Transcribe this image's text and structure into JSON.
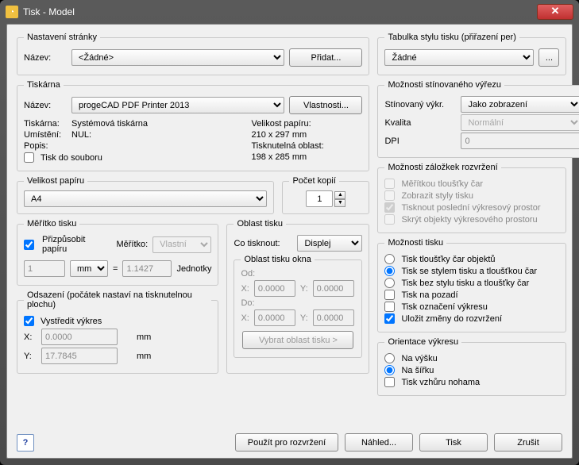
{
  "window": {
    "title": "Tisk - Model"
  },
  "pageSetup": {
    "legend": "Nastavení stránky",
    "nameLabel": "Název:",
    "nameValue": "<Žádné>",
    "addBtn": "Přidat..."
  },
  "styleTable": {
    "legend": "Tabulka stylu tisku (přiřazení per)",
    "value": "Žádné",
    "moreBtn": "..."
  },
  "printer": {
    "legend": "Tiskárna",
    "nameLabel": "Název:",
    "nameValue": "progeCAD PDF Printer 2013",
    "propsBtn": "Vlastnosti...",
    "printerLabel": "Tiskárna:",
    "printerValue": "Systémová tiskárna",
    "locationLabel": "Umístění:",
    "locationValue": "NUL:",
    "descLabel": "Popis:",
    "paperSizeLabel": "Velikost papíru:",
    "paperSizeValue": "210 x 297 mm",
    "printAreaLabel": "Tisknutelná oblast:",
    "printAreaValue": "198 x 285 mm",
    "toFile": "Tisk do souboru"
  },
  "shaded": {
    "legend": "Možnosti stínovaného výřezu",
    "shadeLabel": "Stínovaný výkr.",
    "shadeValue": "Jako zobrazení",
    "qualityLabel": "Kvalita",
    "qualityValue": "Normální",
    "dpiLabel": "DPI",
    "dpiValue": "0"
  },
  "paper": {
    "legend": "Velikost papíru",
    "value": "A4"
  },
  "copies": {
    "legend": "Počet kopií",
    "value": "1"
  },
  "tabOptions": {
    "legend": "Možnosti záložkek rozvržení",
    "opt1": "Měřítkou tloušťky čar",
    "opt2": "Zobrazit styly tisku",
    "opt3": "Tisknout poslední výkresový prostor",
    "opt4": "Skrýt objekty výkresového prostoru"
  },
  "scale": {
    "legend": "Měřítko tisku",
    "fit": "Přizpůsobit papíru",
    "scaleLabel": "Měřítko:",
    "scaleValue": "Vlastní",
    "left": "1",
    "unit": "mm",
    "right": "1.1427",
    "unitsLabel": "Jednotky"
  },
  "area": {
    "legend": "Oblast tisku",
    "whatLabel": "Co tisknout:",
    "whatValue": "Displej",
    "windowLegend": "Oblast tisku okna",
    "fromLabel": "Od:",
    "toLabel": "Do:",
    "x1": "0.0000",
    "y1": "0.0000",
    "x2": "0.0000",
    "y2": "0.0000",
    "xLabel": "X:",
    "yLabel": "Y:",
    "pickBtn": "Vybrat oblast tisku >"
  },
  "plotOptions": {
    "legend": "Možnosti tisku",
    "o1": "Tisk tloušťky čar objektů",
    "o2": "Tisk se stylem tisku a tloušťkou čar",
    "o3": "Tisk bez stylu tisku a tloušťky čar",
    "o4": "Tisk na pozadí",
    "o5": "Tisk označení výkresu",
    "o6": "Uložit změny do rozvržení"
  },
  "offset": {
    "legend": "Odsazení (počátek nastaví na tisknutelnou plochu)",
    "center": "Vystředit výkres",
    "xLabel": "X:",
    "yLabel": "Y:",
    "x": "0.0000",
    "y": "17.7845",
    "unit": "mm"
  },
  "orient": {
    "legend": "Orientace výkresu",
    "portrait": "Na výšku",
    "landscape": "Na šířku",
    "upside": "Tisk vzhůru nohama"
  },
  "footer": {
    "apply": "Použít pro rozvržení",
    "preview": "Náhled...",
    "print": "Tisk",
    "cancel": "Zrušit"
  }
}
